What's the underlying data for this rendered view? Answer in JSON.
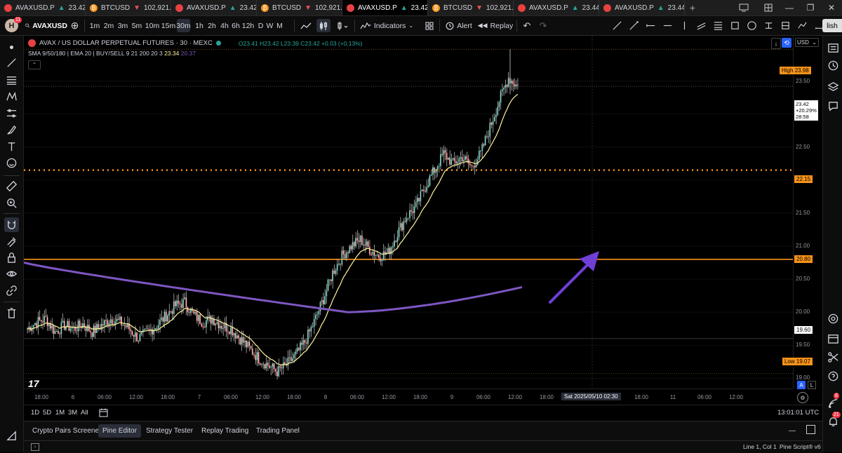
{
  "tabs": [
    {
      "fav": "avax",
      "symbol": "AVAXUSD.P",
      "arrow": "▲",
      "price": "23.42",
      "dir": "up",
      "active": false
    },
    {
      "fav": "btc",
      "symbol": "BTCUSD",
      "arrow": "▼",
      "price": "102,921.3",
      "dir": "dn",
      "active": false
    },
    {
      "fav": "avax",
      "symbol": "AVAXUSD.P",
      "arrow": "▲",
      "price": "23.42",
      "dir": "up",
      "active": false
    },
    {
      "fav": "btc",
      "symbol": "BTCUSD",
      "arrow": "▼",
      "price": "102,921.3",
      "dir": "dn",
      "active": false
    },
    {
      "fav": "avax",
      "symbol": "AVAXUSD.P",
      "arrow": "▲",
      "price": "23.42",
      "dir": "up",
      "active": true
    },
    {
      "fav": "btc",
      "symbol": "BTCUSD",
      "arrow": "▼",
      "price": "102,921.3",
      "dir": "dn",
      "active": false
    },
    {
      "fav": "avax",
      "symbol": "AVAXUSD.P",
      "arrow": "▲",
      "price": "23.44",
      "dir": "up",
      "active": false
    },
    {
      "fav": "avax",
      "symbol": "AVAXUSD.P",
      "arrow": "▲",
      "price": "23.44",
      "dir": "up",
      "active": false
    }
  ],
  "toolbar": {
    "avatar_badge": "11",
    "avatar_letter": "H",
    "symbol": "AVAXUSD",
    "intervals": [
      "1m",
      "2m",
      "3m",
      "5m",
      "10m",
      "15m",
      "30m",
      "1h",
      "2h",
      "4h",
      "6h",
      "12h",
      "D",
      "W",
      "M"
    ],
    "selected_interval": "30m",
    "indicators_label": "Indicators",
    "alert_label": "Alert",
    "replay_label": "Replay",
    "publish_label": "lish"
  },
  "legend": {
    "title": "AVAX / US DOLLAR PERPETUAL FUTURES · 30 · MEXC",
    "ohlc": "O23.41 H23.42 L23.39 C23.42 +0.03 (+0.13%)",
    "indicators_prefix": "SMA 9/50/180 | EMA 20 | BUY/SELL 9 21 200 20 3",
    "ind_value1": "23.34",
    "ind_value2": "20.37"
  },
  "currency": "USD",
  "price_axis": {
    "ticks": [
      "23.50",
      "23.00",
      "22.50",
      "22.00",
      "21.50",
      "21.00",
      "20.50",
      "20.00",
      "19.50",
      "19.00"
    ],
    "high_label": "High",
    "high_value": "23.98",
    "low_label": "Low",
    "low_value": "19.07",
    "current_price": "23.42",
    "current_change": "+20.29%",
    "current_countdown": "28:58",
    "level_dotted": "22.15",
    "level_solid": "20.80",
    "level_marker": "19.60"
  },
  "time_axis": {
    "ticks": [
      "18:00",
      "6",
      "06:00",
      "12:00",
      "18:00",
      "7",
      "06:00",
      "12:00",
      "18:00",
      "8",
      "06:00",
      "12:00",
      "18:00",
      "9",
      "06:00",
      "12:00",
      "18:00",
      "",
      "12:00",
      "18:00",
      "11",
      "06:00",
      "12:00"
    ],
    "crosshair_label": "Sat 2025/05/10   02:30"
  },
  "range_bar": {
    "ranges": [
      "1D",
      "5D",
      "1M",
      "3M",
      "All"
    ],
    "clock": "13:01:01 UTC",
    "auto_a": "A",
    "auto_l": "L"
  },
  "bottom_tabs": [
    "Crypto Pairs Screener",
    "Pine Editor",
    "Strategy Tester",
    "Replay Trading",
    "Trading Panel"
  ],
  "selected_bottom_tab": "Pine Editor",
  "status": {
    "position": "Line 1, Col 1",
    "version": "Pine Script® v6"
  },
  "right_badges": {
    "notifications": "8",
    "feed": "21"
  },
  "colors": {
    "up": "#26a69a",
    "down": "#ef5350",
    "ema": "#fff59d",
    "sma": "#7e57c2",
    "level": "#f7931a",
    "arrow": "#6f3fd6",
    "background": "#000000"
  },
  "chart_data": {
    "type": "candlestick",
    "symbol": "AVAX / US DOLLAR PERPETUAL FUTURES",
    "interval": "30",
    "exchange": "MEXC",
    "x_range": [
      "2025-05-05 18:00",
      "2025-05-09 12:30"
    ],
    "ylim": [
      19.0,
      24.1
    ],
    "high": 23.98,
    "low": 19.07,
    "last": 23.42,
    "horizontal_levels": [
      {
        "value": 22.15,
        "style": "dotted",
        "color": "#f7931a"
      },
      {
        "value": 20.8,
        "style": "solid",
        "color": "#f7931a"
      }
    ],
    "close_path": [
      19.75,
      19.85,
      19.9,
      19.7,
      19.8,
      19.75,
      19.82,
      19.7,
      19.8,
      19.9,
      19.85,
      19.75,
      19.6,
      19.7,
      19.8,
      19.95,
      20.1,
      20.15,
      19.95,
      19.85,
      19.9,
      19.8,
      19.75,
      19.6,
      19.45,
      19.3,
      19.2,
      19.1,
      19.2,
      19.35,
      19.55,
      19.85,
      20.2,
      20.6,
      20.85,
      21.0,
      21.1,
      20.95,
      20.85,
      20.9,
      21.2,
      21.45,
      21.6,
      21.9,
      22.15,
      22.4,
      22.25,
      22.35,
      22.2,
      22.4,
      22.8,
      23.2,
      23.55,
      23.42
    ],
    "sma180": [
      {
        "x": "start",
        "y": 20.75
      },
      {
        "x": "mid",
        "y": 20.0
      },
      {
        "x": "end",
        "y": 20.38
      }
    ]
  }
}
